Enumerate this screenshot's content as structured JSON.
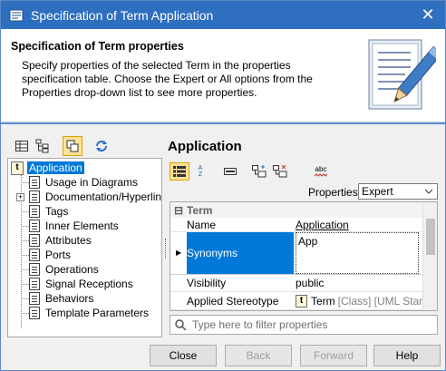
{
  "window": {
    "title": "Specification of Term Application",
    "close_glyph": "✕"
  },
  "header": {
    "title": "Specification of Term properties",
    "description": "Specify properties of the selected Term in the properties specification table. Choose the Expert or All options from the Properties drop-down list to see more properties."
  },
  "left_toolbar": {
    "buttons": [
      "table-view-icon",
      "tree-view-icon",
      "copy-icon",
      "refresh-icon"
    ]
  },
  "tree": {
    "items": [
      {
        "label": "Application",
        "selected": true
      },
      {
        "label": "Usage in Diagrams"
      },
      {
        "label": "Documentation/Hyperlinks"
      },
      {
        "label": "Tags"
      },
      {
        "label": "Inner Elements"
      },
      {
        "label": "Attributes"
      },
      {
        "label": "Ports"
      },
      {
        "label": "Operations"
      },
      {
        "label": "Signal Receptions"
      },
      {
        "label": "Behaviors"
      },
      {
        "label": "Template Parameters"
      }
    ]
  },
  "right": {
    "title": "Application",
    "properties_label": "Properties:",
    "properties_value": "Expert",
    "sort_icon_text": "A Z",
    "abc_icon_text": "abc"
  },
  "grid": {
    "group": "Term",
    "rows": [
      {
        "name": "Name",
        "value": "Application"
      },
      {
        "name": "Synonyms",
        "value": "App"
      },
      {
        "name": "Visibility",
        "value": "public"
      },
      {
        "name": "Applied Stereotype",
        "value": "Term",
        "value_suffix": "[Class] [UML Standard"
      }
    ]
  },
  "filter": {
    "placeholder": "Type here to filter properties"
  },
  "buttons": {
    "close": "Close",
    "back": "Back",
    "forward": "Forward",
    "help": "Help"
  },
  "colors": {
    "titlebar": "#2f6fbf",
    "selection": "#0078d7",
    "term_icon_bg": "#fff6d5"
  }
}
